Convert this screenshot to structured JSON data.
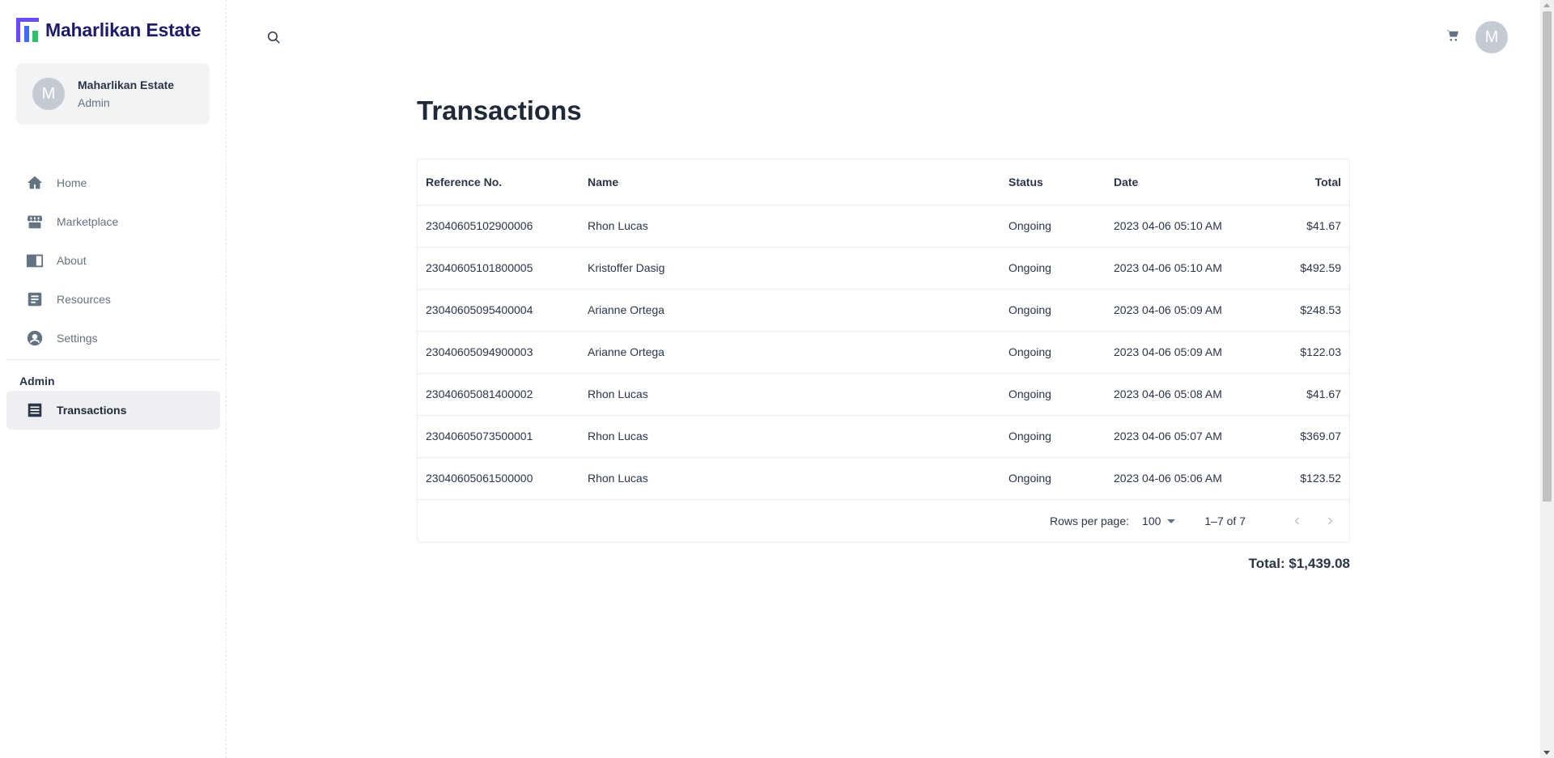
{
  "brand": {
    "name": "Maharlikan Estate",
    "colors": {
      "primary": "#1e1b6a",
      "logo_purple": "#6a4cf5",
      "logo_blue": "#3a6ef5",
      "logo_green": "#2fbf71"
    }
  },
  "account": {
    "initial": "M",
    "name": "Maharlikan Estate",
    "role": "Admin"
  },
  "nav": {
    "items": [
      {
        "label": "Home",
        "icon": "home-icon"
      },
      {
        "label": "Marketplace",
        "icon": "store-icon"
      },
      {
        "label": "About",
        "icon": "book-icon"
      },
      {
        "label": "Resources",
        "icon": "document-icon"
      },
      {
        "label": "Settings",
        "icon": "account-circle-icon"
      }
    ],
    "section_label": "Admin",
    "admin_items": [
      {
        "label": "Transactions",
        "icon": "receipt-icon",
        "active": true
      }
    ]
  },
  "header": {
    "search_icon": "search-icon",
    "cart_icon": "cart-icon",
    "avatar_initial": "M"
  },
  "page": {
    "title": "Transactions"
  },
  "table": {
    "columns": [
      "Reference No.",
      "Name",
      "Status",
      "Date",
      "Total"
    ],
    "rows": [
      {
        "ref": "23040605102900006",
        "name": "Rhon Lucas",
        "status": "Ongoing",
        "date": "2023 04-06 05:10 AM",
        "total": "$41.67"
      },
      {
        "ref": "23040605101800005",
        "name": "Kristoffer Dasig",
        "status": "Ongoing",
        "date": "2023 04-06 05:10 AM",
        "total": "$492.59"
      },
      {
        "ref": "23040605095400004",
        "name": "Arianne Ortega",
        "status": "Ongoing",
        "date": "2023 04-06 05:09 AM",
        "total": "$248.53"
      },
      {
        "ref": "23040605094900003",
        "name": "Arianne Ortega",
        "status": "Ongoing",
        "date": "2023 04-06 05:09 AM",
        "total": "$122.03"
      },
      {
        "ref": "23040605081400002",
        "name": "Rhon Lucas",
        "status": "Ongoing",
        "date": "2023 04-06 05:08 AM",
        "total": "$41.67"
      },
      {
        "ref": "23040605073500001",
        "name": "Rhon Lucas",
        "status": "Ongoing",
        "date": "2023 04-06 05:07 AM",
        "total": "$369.07"
      },
      {
        "ref": "23040605061500000",
        "name": "Rhon Lucas",
        "status": "Ongoing",
        "date": "2023 04-06 05:06 AM",
        "total": "$123.52"
      }
    ]
  },
  "pagination": {
    "rows_per_page_label": "Rows per page:",
    "rows_per_page_value": "100",
    "range": "1–7 of 7"
  },
  "grand_total": "Total: $1,439.08"
}
